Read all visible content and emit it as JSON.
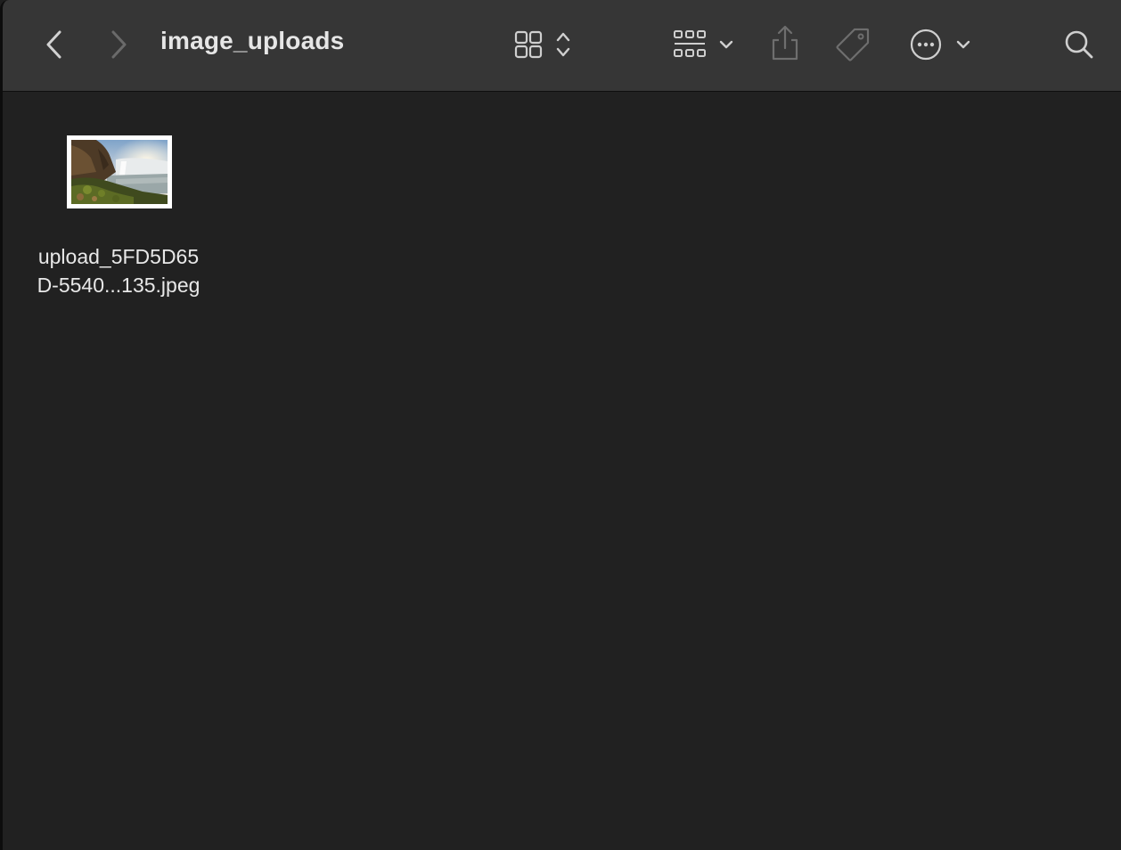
{
  "window": {
    "title": "image_uploads"
  },
  "toolbar": {
    "back_icon": "chevron-left-icon",
    "forward_icon": "chevron-right-icon",
    "view_icon": "grid-view-icon",
    "group_icon": "group-by-icon",
    "share_icon": "share-icon",
    "tag_icon": "tag-icon",
    "more_icon": "ellipsis-circle-icon",
    "search_icon": "search-icon"
  },
  "files": [
    {
      "name_line1": "upload_5FD5D65",
      "name_line2": "D-5540...135.jpeg",
      "thumbnail": "waterfall-landscape"
    }
  ],
  "colors": {
    "toolbar_bg": "#363636",
    "content_bg": "#212121",
    "text": "#e6e6e6",
    "icon_active": "#d0d0d0",
    "icon_disabled": "#6e6e6e"
  }
}
